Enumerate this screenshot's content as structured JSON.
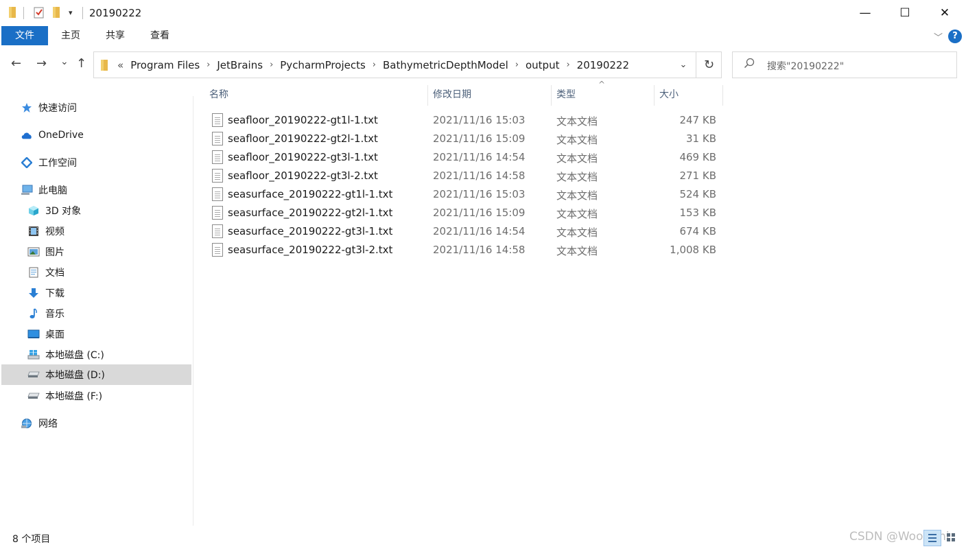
{
  "window": {
    "title": "20190222",
    "minimize": "—",
    "maximize": "☐",
    "close": "✕"
  },
  "ribbon": {
    "tabs": [
      {
        "label": "文件",
        "active": true
      },
      {
        "label": "主页"
      },
      {
        "label": "共享"
      },
      {
        "label": "查看"
      }
    ],
    "help_label": "?"
  },
  "address": {
    "back": "←",
    "forward": "→",
    "recent": "⌄",
    "up": "↑",
    "overflow": "«",
    "breadcrumbs": [
      "Program Files",
      "JetBrains",
      "PycharmProjects",
      "BathymetricDepthModel",
      "output",
      "20190222"
    ],
    "separator": "›",
    "dropdown": "⌄",
    "refresh": "↻"
  },
  "search": {
    "placeholder": "搜索\"20190222\""
  },
  "sidebar": {
    "items": [
      {
        "label": "快速访问",
        "icon": "star-icon"
      },
      {
        "label": "OneDrive",
        "icon": "cloud-icon"
      },
      {
        "label": "工作空间",
        "icon": "workspace-icon"
      },
      {
        "label": "此电脑",
        "icon": "computer-icon"
      },
      {
        "label": "3D 对象",
        "icon": "cube-icon"
      },
      {
        "label": "视频",
        "icon": "film-icon"
      },
      {
        "label": "图片",
        "icon": "picture-icon"
      },
      {
        "label": "文档",
        "icon": "document-icon"
      },
      {
        "label": "下载",
        "icon": "download-arrow-icon"
      },
      {
        "label": "音乐",
        "icon": "music-note-icon"
      },
      {
        "label": "桌面",
        "icon": "desktop-icon"
      },
      {
        "label": "本地磁盘 (C:)",
        "icon": "windows-drive-icon"
      },
      {
        "label": "本地磁盘 (D:)",
        "icon": "drive-icon",
        "selected": true
      },
      {
        "label": "本地磁盘 (F:)",
        "icon": "drive-icon"
      },
      {
        "label": "网络",
        "icon": "network-icon"
      }
    ]
  },
  "columns": {
    "name": "名称",
    "modified": "修改日期",
    "type": "类型",
    "size": "大小",
    "sort_caret": "^"
  },
  "files": [
    {
      "name": "seafloor_20190222-gt1l-1.txt",
      "modified": "2021/11/16 15:03",
      "type": "文本文档",
      "size": "247 KB"
    },
    {
      "name": "seafloor_20190222-gt2l-1.txt",
      "modified": "2021/11/16 15:09",
      "type": "文本文档",
      "size": "31 KB"
    },
    {
      "name": "seafloor_20190222-gt3l-1.txt",
      "modified": "2021/11/16 14:54",
      "type": "文本文档",
      "size": "469 KB"
    },
    {
      "name": "seafloor_20190222-gt3l-2.txt",
      "modified": "2021/11/16 14:58",
      "type": "文本文档",
      "size": "271 KB"
    },
    {
      "name": "seasurface_20190222-gt1l-1.txt",
      "modified": "2021/11/16 15:03",
      "type": "文本文档",
      "size": "524 KB"
    },
    {
      "name": "seasurface_20190222-gt2l-1.txt",
      "modified": "2021/11/16 15:09",
      "type": "文本文档",
      "size": "153 KB"
    },
    {
      "name": "seasurface_20190222-gt3l-1.txt",
      "modified": "2021/11/16 14:54",
      "type": "文本文档",
      "size": "674 KB"
    },
    {
      "name": "seasurface_20190222-gt3l-2.txt",
      "modified": "2021/11/16 14:58",
      "type": "文本文档",
      "size": "1,008 KB"
    }
  ],
  "status": {
    "item_count": "8 个项目",
    "watermark": "CSDN @WoogChi"
  },
  "colors": {
    "accent": "#1a6fc6",
    "selection": "#d9d9d9"
  }
}
